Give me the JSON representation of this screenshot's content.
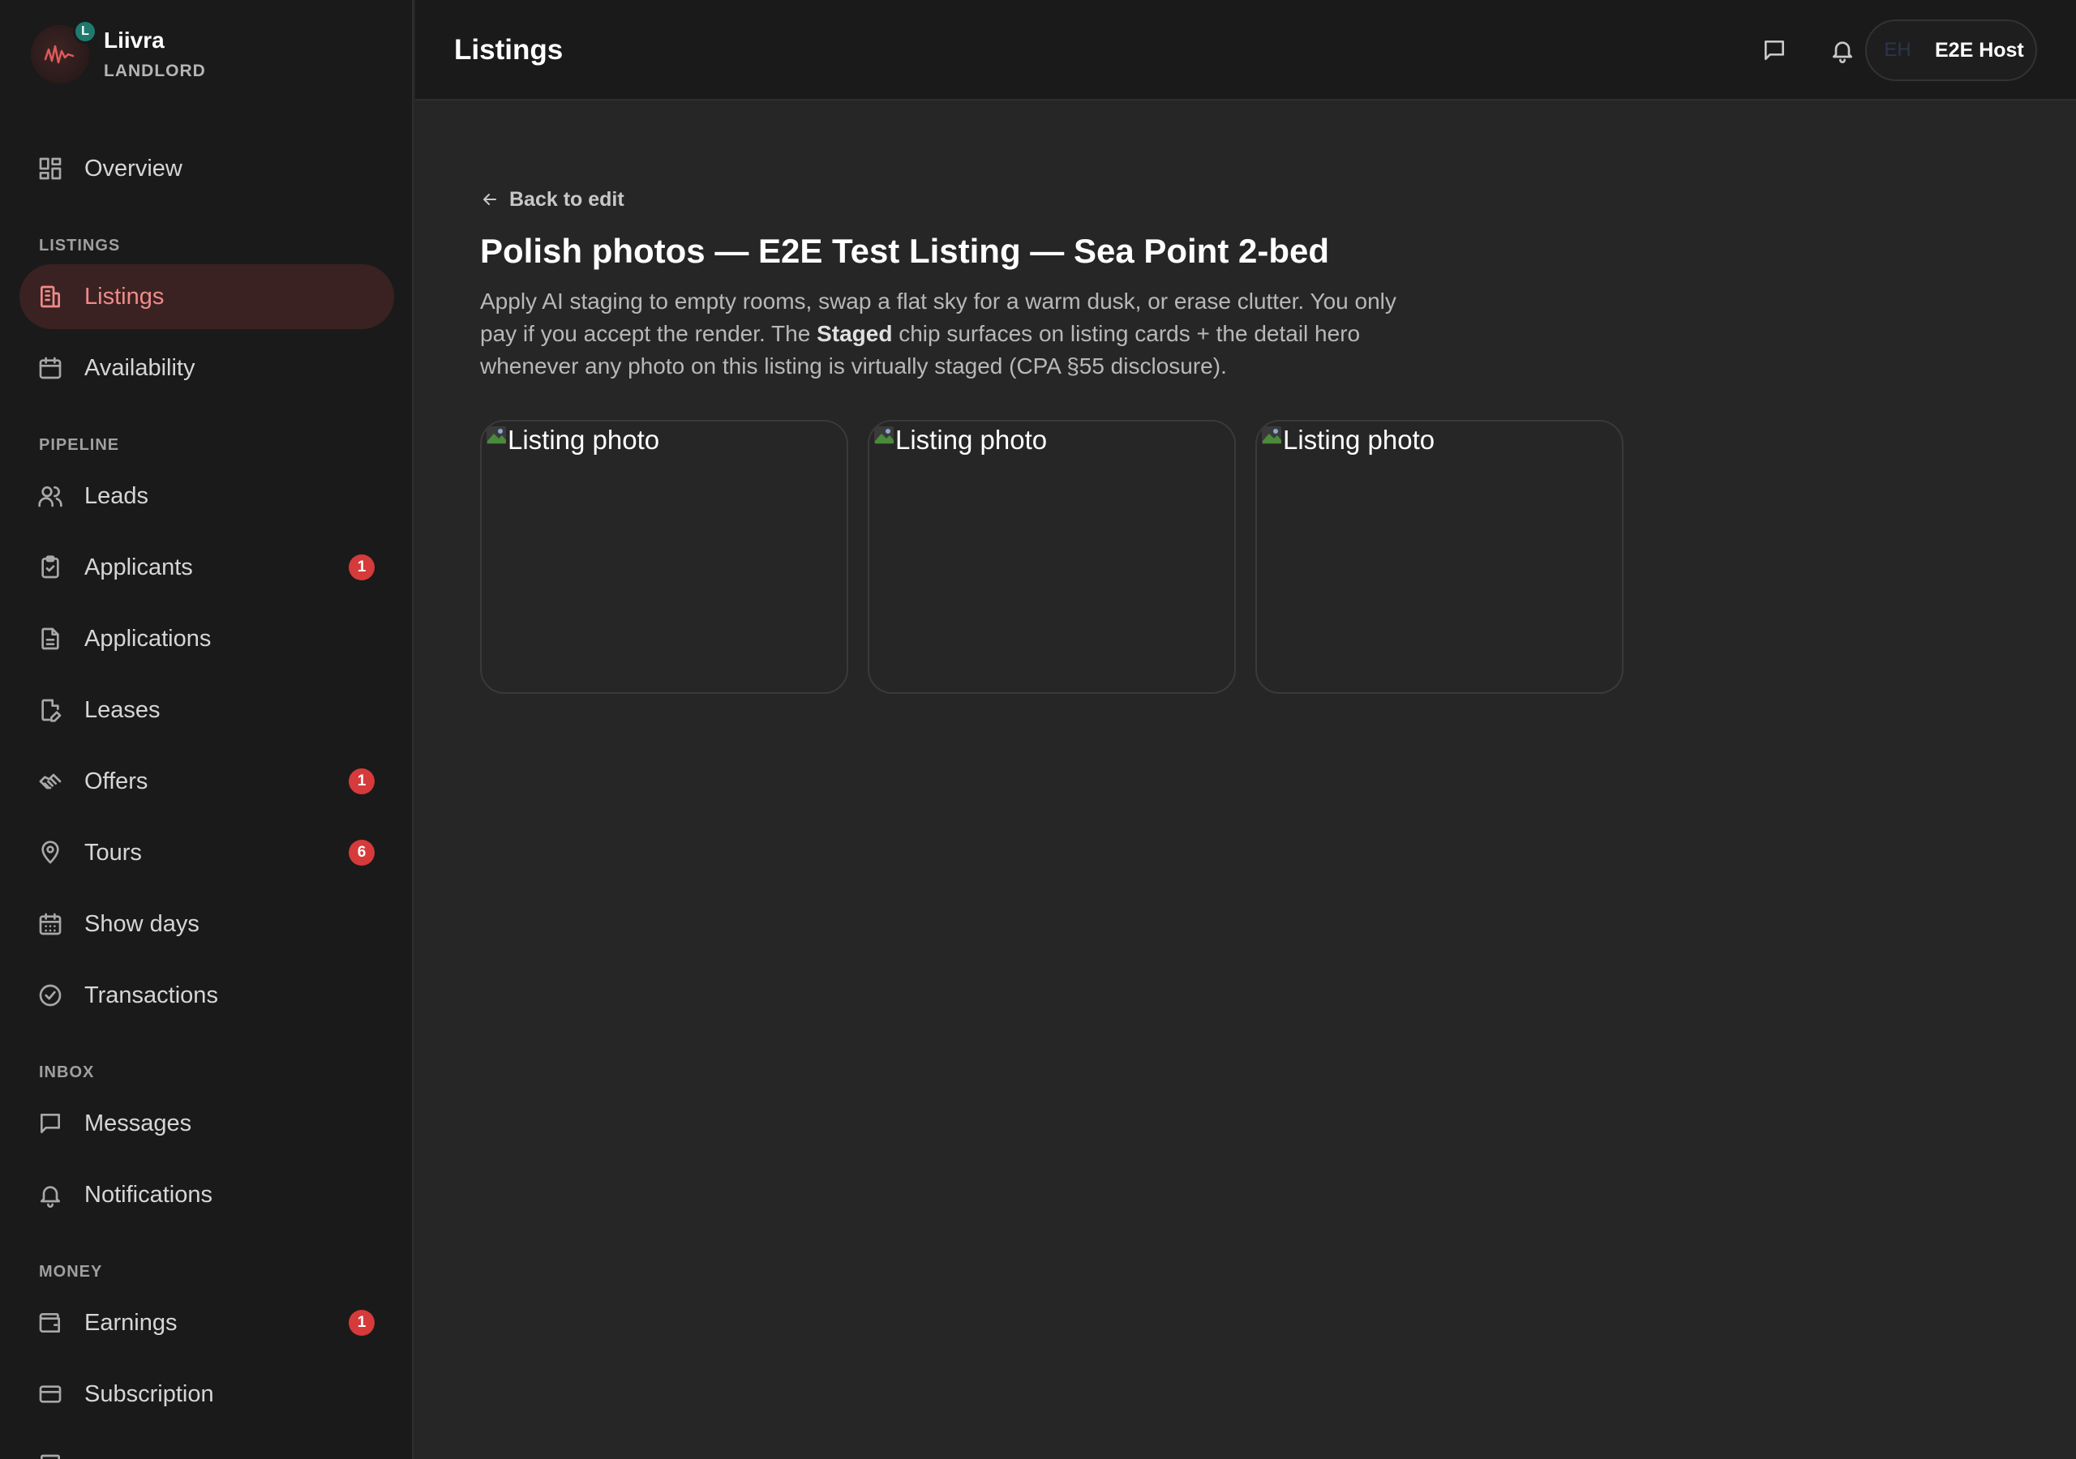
{
  "brand": {
    "name": "Liivra",
    "role": "LANDLORD",
    "badge": "L"
  },
  "sidebar": {
    "overview": "Overview",
    "sections": {
      "listings": "LISTINGS",
      "pipeline": "PIPELINE",
      "inbox": "INBOX",
      "money": "MONEY"
    },
    "items": {
      "listings": "Listings",
      "availability": "Availability",
      "leads": "Leads",
      "applicants": "Applicants",
      "applications": "Applications",
      "leases": "Leases",
      "offers": "Offers",
      "tours": "Tours",
      "show_days": "Show days",
      "transactions": "Transactions",
      "messages": "Messages",
      "notifications": "Notifications",
      "earnings": "Earnings",
      "subscription": "Subscription"
    },
    "badges": {
      "applicants": "1",
      "offers": "1",
      "tours": "6",
      "earnings": "1"
    }
  },
  "topbar": {
    "title": "Listings",
    "user": {
      "initials": "EH",
      "name": "E2E Host"
    }
  },
  "main": {
    "back_label": "Back to edit",
    "title": "Polish photos — E2E Test Listing — Sea Point 2-bed",
    "desc_part1": "Apply AI staging to empty rooms, swap a flat sky for a warm dusk, or erase clutter. You only pay if you accept the render. The ",
    "desc_bold": "Staged",
    "desc_part2": " chip surfaces on listing cards + the detail hero whenever any photo on this listing is virtually staged (CPA §55 disclosure).",
    "photos": [
      {
        "alt": "Listing photo"
      },
      {
        "alt": "Listing photo"
      },
      {
        "alt": "Listing photo"
      }
    ]
  },
  "colors": {
    "accent": "#f08a8a",
    "active_bg": "#3a2222",
    "badge": "#d63a3a",
    "sidebar_bg": "#1a1a1a",
    "main_bg": "#262626"
  }
}
